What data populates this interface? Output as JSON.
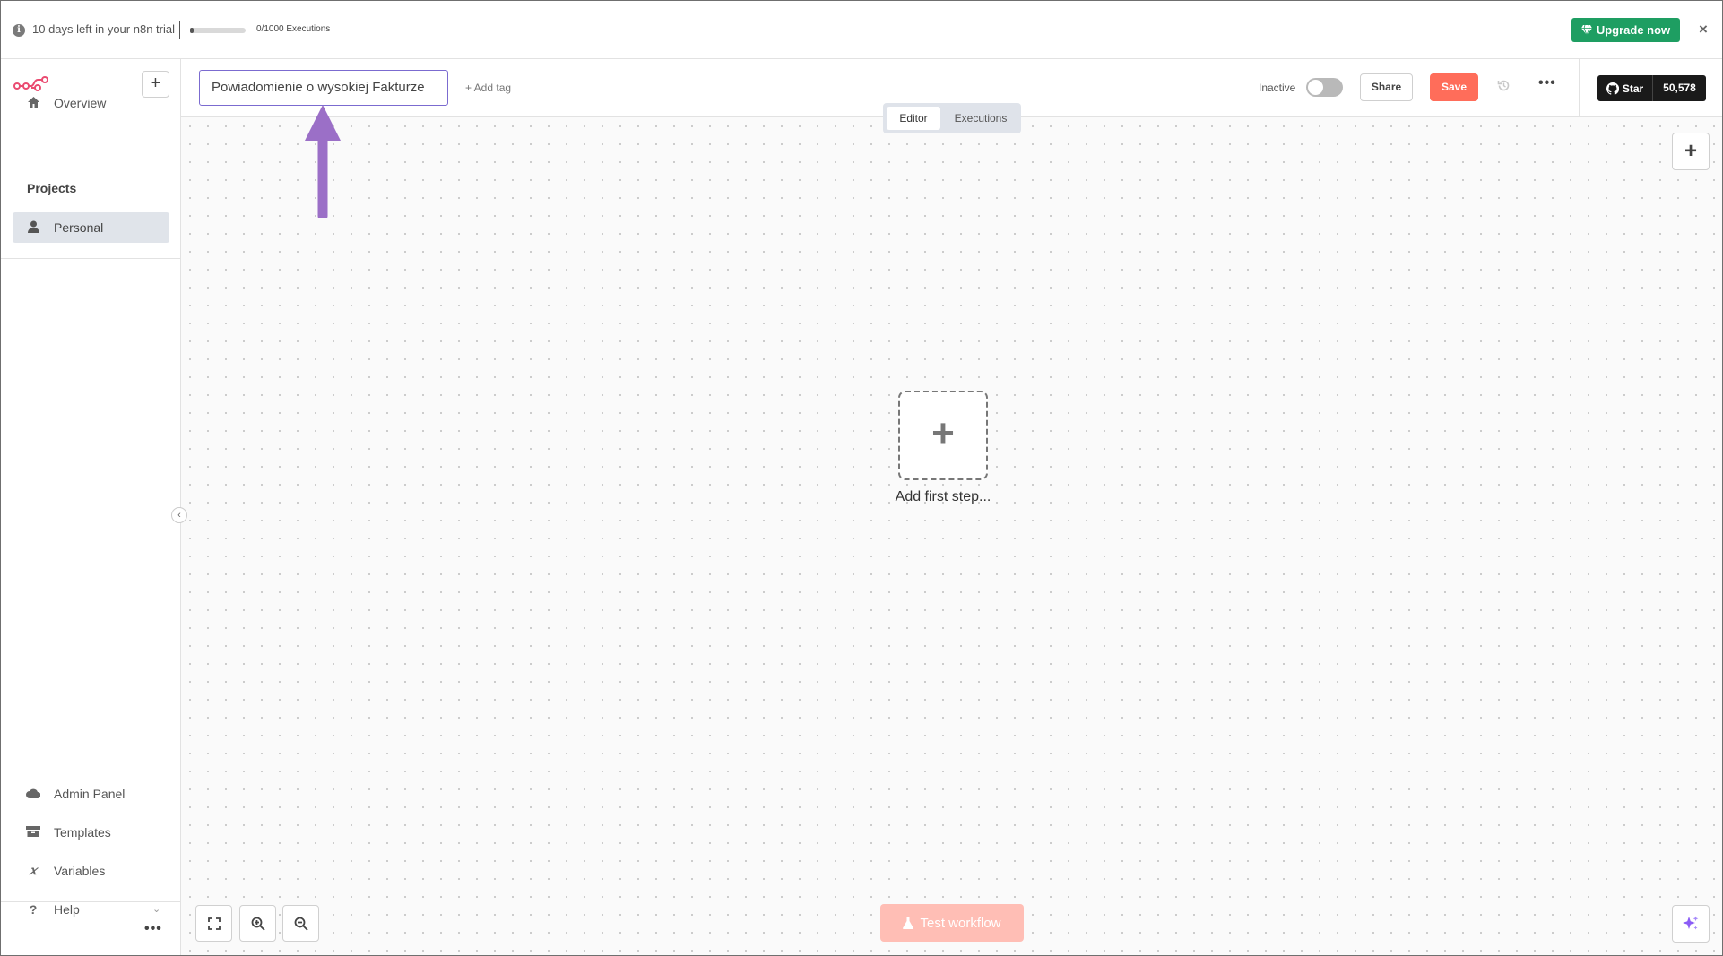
{
  "banner": {
    "trial_text": "10 days left in your n8n trial",
    "executions_text": "0/1000 Executions",
    "executions_progress": 0.0,
    "upgrade_label": "Upgrade now",
    "close_glyph": "×"
  },
  "sidebar": {
    "new_glyph": "+",
    "items": [
      {
        "label": "Overview",
        "icon": "home-icon"
      },
      {
        "label": "Personal",
        "icon": "user-icon",
        "active": true
      },
      {
        "label": "Admin Panel",
        "icon": "cloud-icon"
      },
      {
        "label": "Templates",
        "icon": "box-icon"
      },
      {
        "label": "Variables",
        "icon": "variable-icon"
      },
      {
        "label": "Help",
        "icon": "question-icon"
      }
    ],
    "projects_label": "Projects",
    "more_glyph": "•••",
    "collapse_glyph": "‹"
  },
  "header": {
    "workflow_name": "Powiadomienie o wysokiej Fakturze",
    "add_tag": "+ Add tag",
    "inactive_label": "Inactive",
    "share_label": "Share",
    "save_label": "Save",
    "more_glyph": "•••",
    "github": {
      "star_label": "Star",
      "count": "50,578"
    }
  },
  "view_tabs": {
    "editor": "Editor",
    "executions": "Executions"
  },
  "canvas": {
    "add_node_glyph": "+",
    "first_step_glyph": "+",
    "first_step_label": "Add first step...",
    "test_workflow_label": "Test workflow"
  },
  "colors": {
    "accent": "#ff6d5a",
    "upgrade": "#1e9e62",
    "annotation_arrow": "#9b6fc7",
    "input_focus": "#7b6bd0"
  }
}
